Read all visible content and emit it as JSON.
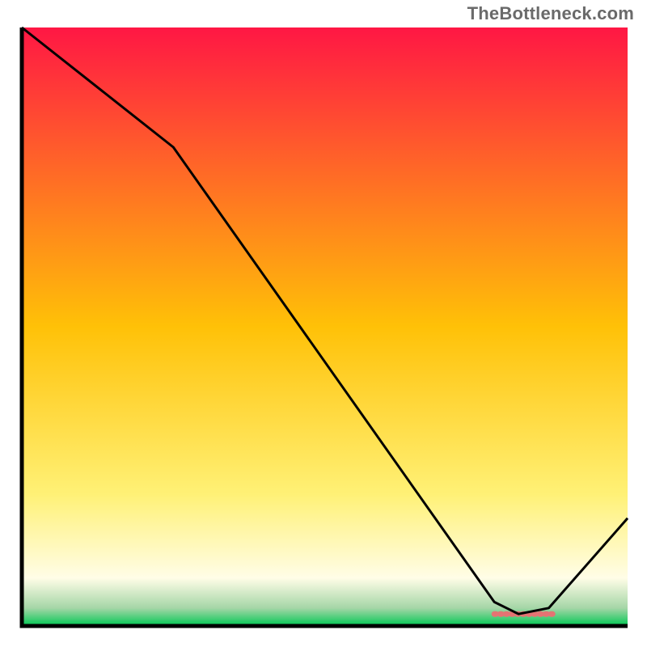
{
  "watermark": "TheBottleneck.com",
  "chart_data": {
    "type": "line",
    "title": "",
    "xlabel": "",
    "ylabel": "",
    "xlim": [
      0,
      100
    ],
    "ylim": [
      0,
      100
    ],
    "x": [
      0,
      25,
      78,
      82,
      87,
      100
    ],
    "values": [
      100,
      80,
      4,
      2,
      3,
      18
    ],
    "gradient_stops": [
      {
        "offset": 0,
        "color": "#FF1744"
      },
      {
        "offset": 50,
        "color": "#FFC107"
      },
      {
        "offset": 78,
        "color": "#FFF176"
      },
      {
        "offset": 92,
        "color": "#FFFDE7"
      },
      {
        "offset": 97,
        "color": "#A5D6A7"
      },
      {
        "offset": 100,
        "color": "#00C853"
      }
    ],
    "marker": {
      "x_start": 78,
      "x_end": 88,
      "y": 2,
      "color": "#E57373"
    },
    "axis_color": "#000000",
    "line_color": "#000000"
  }
}
